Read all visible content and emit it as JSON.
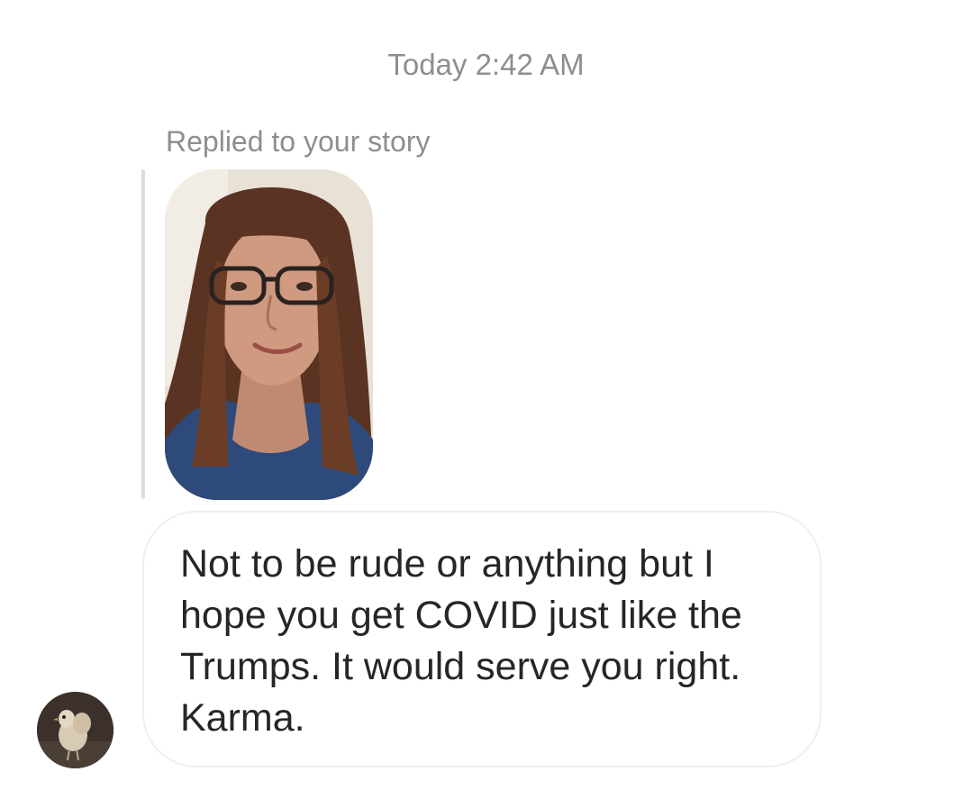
{
  "thread": {
    "timestamp": "Today 2:42 AM",
    "reply_context": "Replied to your story",
    "message": "Not to be rude or anything but I\nhope you get COVID just like the\nTrumps. It would serve you right.\nKarma."
  },
  "colors": {
    "meta_text": "#8e8e8e",
    "message_text": "#262626",
    "bubble_border": "#efefef",
    "quote_bar": "#dcdcdc",
    "background": "#ffffff"
  },
  "icons": {
    "story_thumbnail": "story-preview-image",
    "sender_avatar": "avatar-image"
  }
}
